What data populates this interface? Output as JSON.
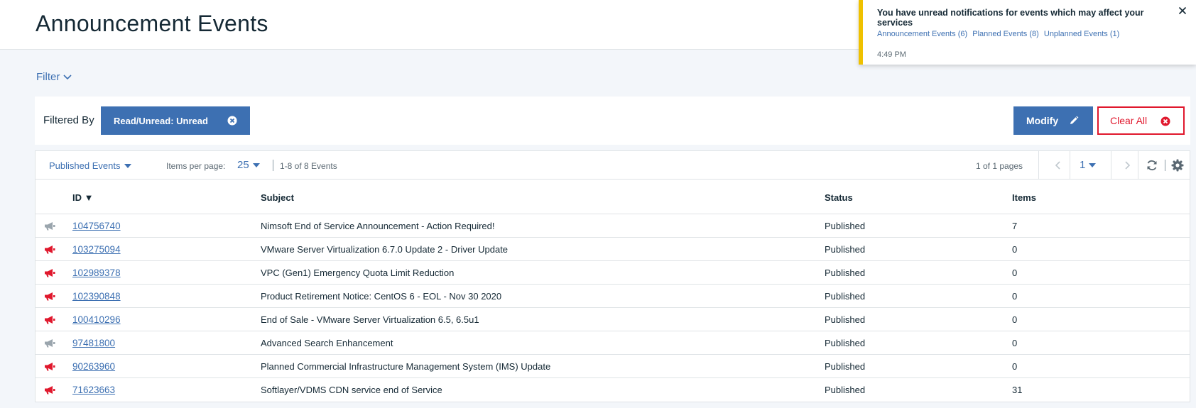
{
  "header": {
    "title": "Announcement Events"
  },
  "filter": {
    "toggle_label": "Filter",
    "filtered_by_label": "Filtered By",
    "chip_label": "Read/Unread: Unread",
    "modify_label": "Modify",
    "clear_label": "Clear All"
  },
  "toolbar": {
    "published_label": "Published Events",
    "items_per_page_label": "Items per page:",
    "items_per_page": "25",
    "range_text": "1-8 of 8 Events",
    "pages_text": "1 of 1 pages",
    "current_page": "1"
  },
  "table": {
    "headers": {
      "id": "ID ▼",
      "subject": "Subject",
      "status": "Status",
      "items": "Items"
    },
    "rows": [
      {
        "icon": "megaphone-gray-icon",
        "id": "104756740",
        "subject": "Nimsoft End of Service Announcement - Action Required!",
        "status": "Published",
        "items": "7"
      },
      {
        "icon": "megaphone-red-icon",
        "id": "103275094",
        "subject": "VMware Server Virtualization 6.7.0 Update 2 - Driver Update",
        "status": "Published",
        "items": "0"
      },
      {
        "icon": "megaphone-red-icon",
        "id": "102989378",
        "subject": "VPC (Gen1) Emergency Quota Limit Reduction",
        "status": "Published",
        "items": "0"
      },
      {
        "icon": "megaphone-red-icon",
        "id": "102390848",
        "subject": "Product Retirement Notice: CentOS 6 - EOL - Nov 30 2020",
        "status": "Published",
        "items": "0"
      },
      {
        "icon": "megaphone-red-icon",
        "id": "100410296",
        "subject": "End of Sale - VMware Server Virtualization 6.5, 6.5u1",
        "status": "Published",
        "items": "0"
      },
      {
        "icon": "megaphone-gray-icon",
        "id": "97481800",
        "subject": "Advanced Search Enhancement",
        "status": "Published",
        "items": "0"
      },
      {
        "icon": "megaphone-red-icon",
        "id": "90263960",
        "subject": "Planned Commercial Infrastructure Management System (IMS) Update",
        "status": "Published",
        "items": "0"
      },
      {
        "icon": "megaphone-red-icon",
        "id": "71623663",
        "subject": "Softlayer/VDMS CDN service end of Service",
        "status": "Published",
        "items": "31"
      }
    ]
  },
  "notification": {
    "title": "You have unread notifications for events which may affect your services",
    "links": [
      "Announcement Events (6)",
      "Planned Events (8)",
      "Unplanned Events (1)"
    ],
    "time": "4:49 PM"
  },
  "colors": {
    "accent": "#3d70b2",
    "danger": "#e0182d",
    "warning": "#efc100",
    "icon_gray": "#9aa5ad"
  }
}
